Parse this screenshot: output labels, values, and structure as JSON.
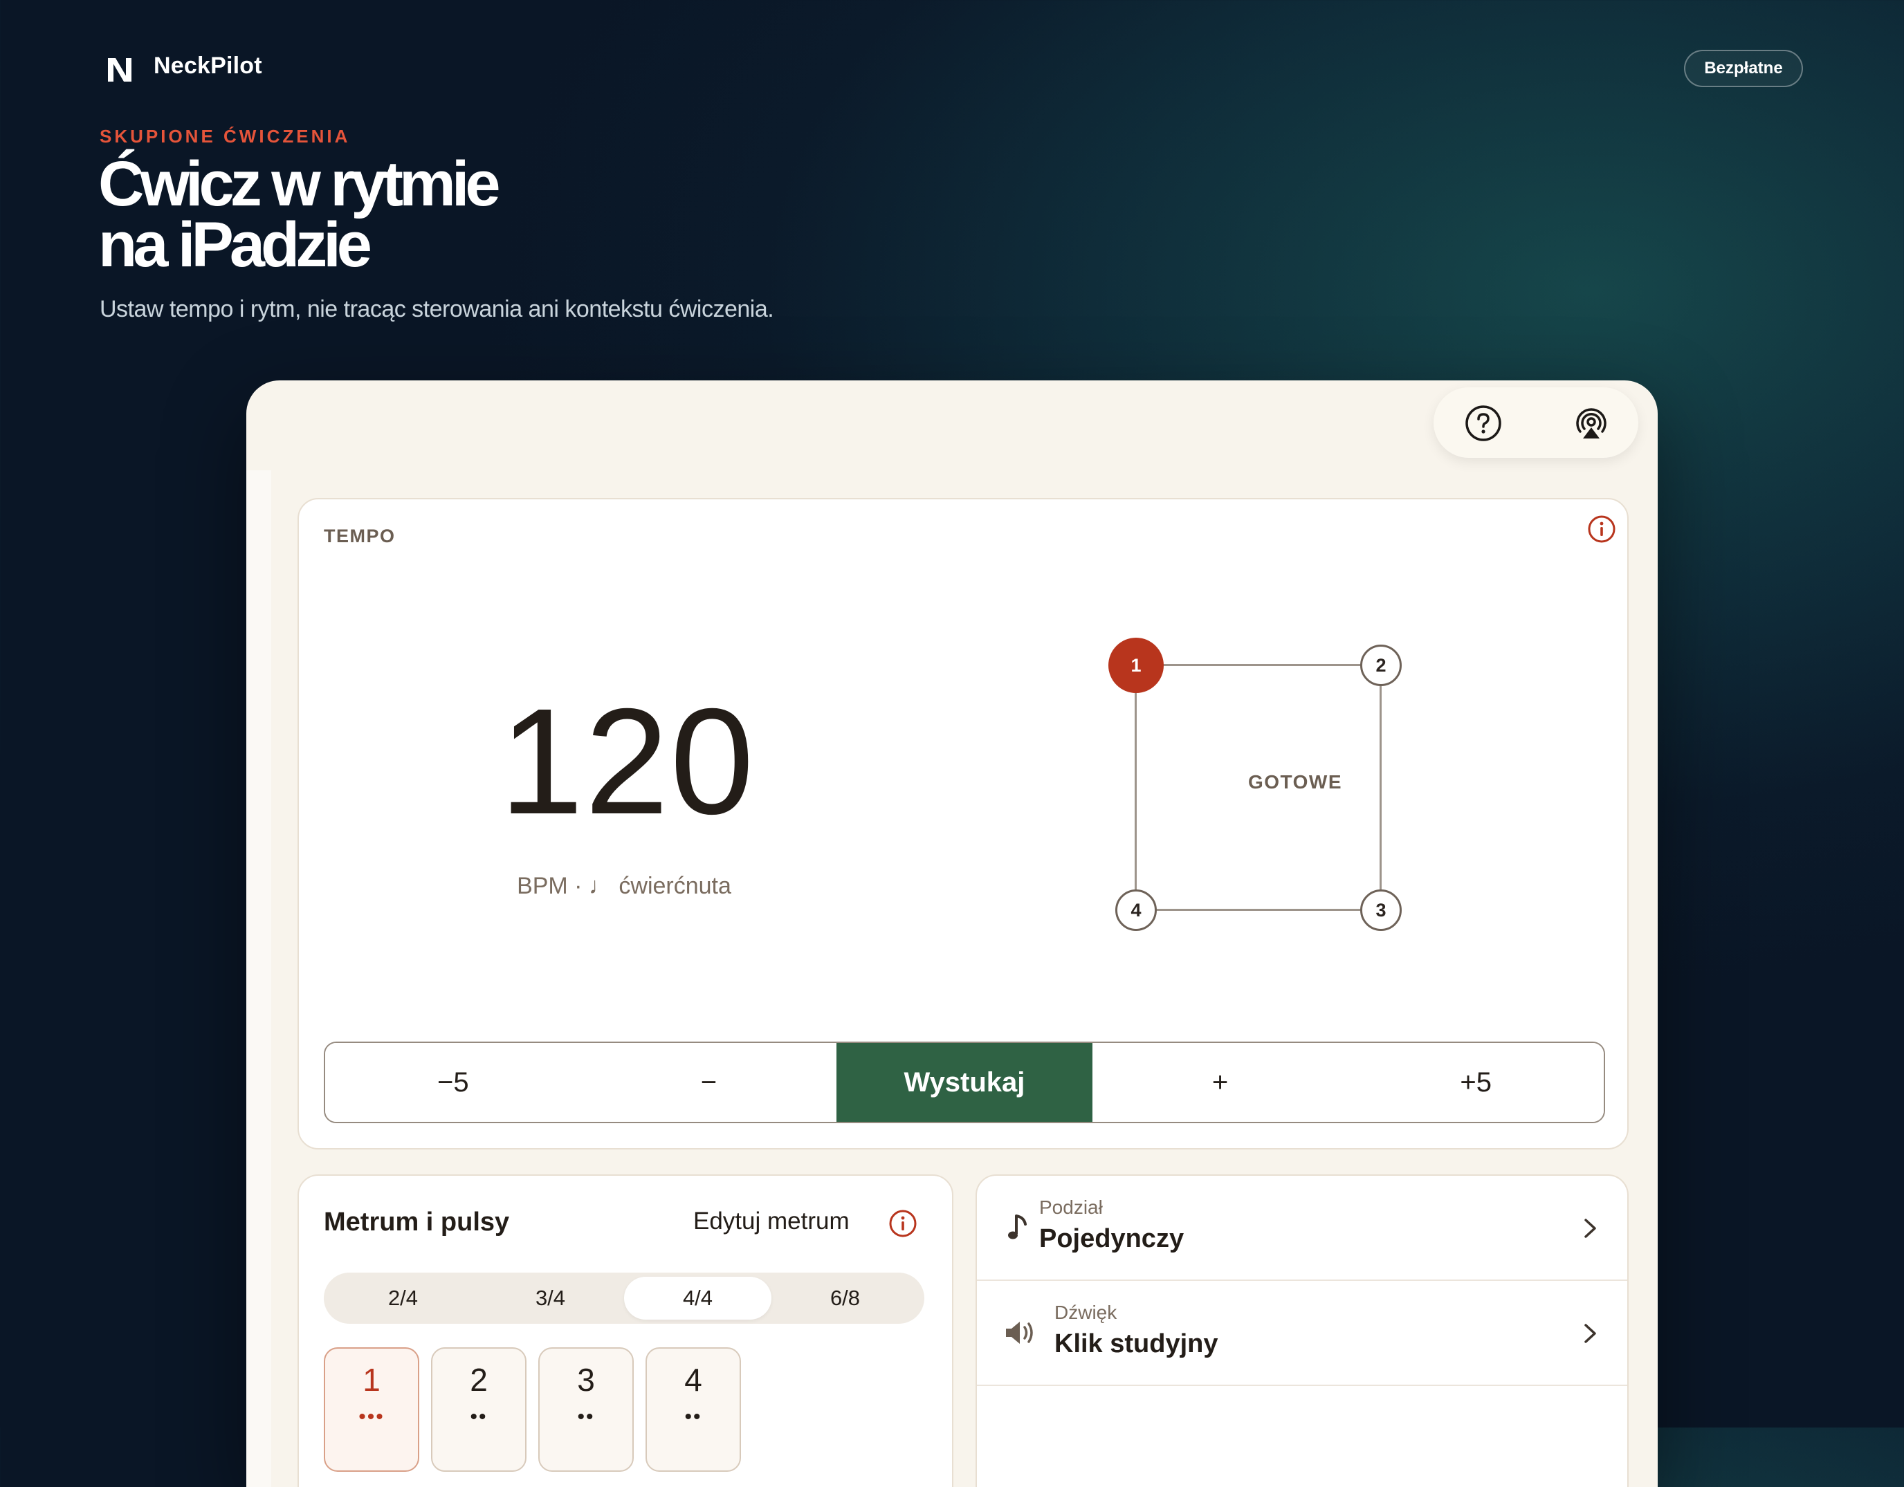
{
  "brand": {
    "name": "NeckPilot",
    "cta": "Bezpłatne"
  },
  "hero": {
    "eyebrow": "SKUPIONE ĆWICZENIA",
    "headline_line1": "Ćwicz w rytmie",
    "headline_line2": "na iPadzie",
    "subtitle": "Ustaw tempo i rytm, nie tracąc sterowania ani kontekstu ćwiczenia."
  },
  "toolbar": {
    "icons": [
      "help-icon",
      "airplay-icon"
    ]
  },
  "tempo": {
    "label": "TEMPO",
    "bpm": "120",
    "caption": "BPM · ♩ ćwierćnuta",
    "status": "GOTOWE",
    "beats": [
      "1",
      "2",
      "3",
      "4"
    ],
    "active_beat": "1",
    "controls": [
      "−5",
      "−",
      "Wystukaj",
      "+",
      "+5"
    ]
  },
  "meter": {
    "title": "Metrum i pulsy",
    "edit_label": "Edytuj metrum",
    "options": [
      "2/4",
      "3/4",
      "4/4",
      "6/8"
    ],
    "selected": "4/4",
    "tiles": [
      {
        "num": "1",
        "dots": "•••"
      },
      {
        "num": "2",
        "dots": "••"
      },
      {
        "num": "3",
        "dots": "••"
      },
      {
        "num": "4",
        "dots": "••"
      }
    ]
  },
  "settings": {
    "rows": [
      {
        "sub": "Podział",
        "main": "Pojedynczy",
        "icon": "music-note-icon"
      },
      {
        "sub": "Dźwięk",
        "main": "Klik studyjny",
        "icon": "speaker-icon"
      }
    ]
  },
  "colors": {
    "accent_red": "#b8351d",
    "primary_green": "#2f6244",
    "eyebrow_orange": "#e5543a"
  }
}
